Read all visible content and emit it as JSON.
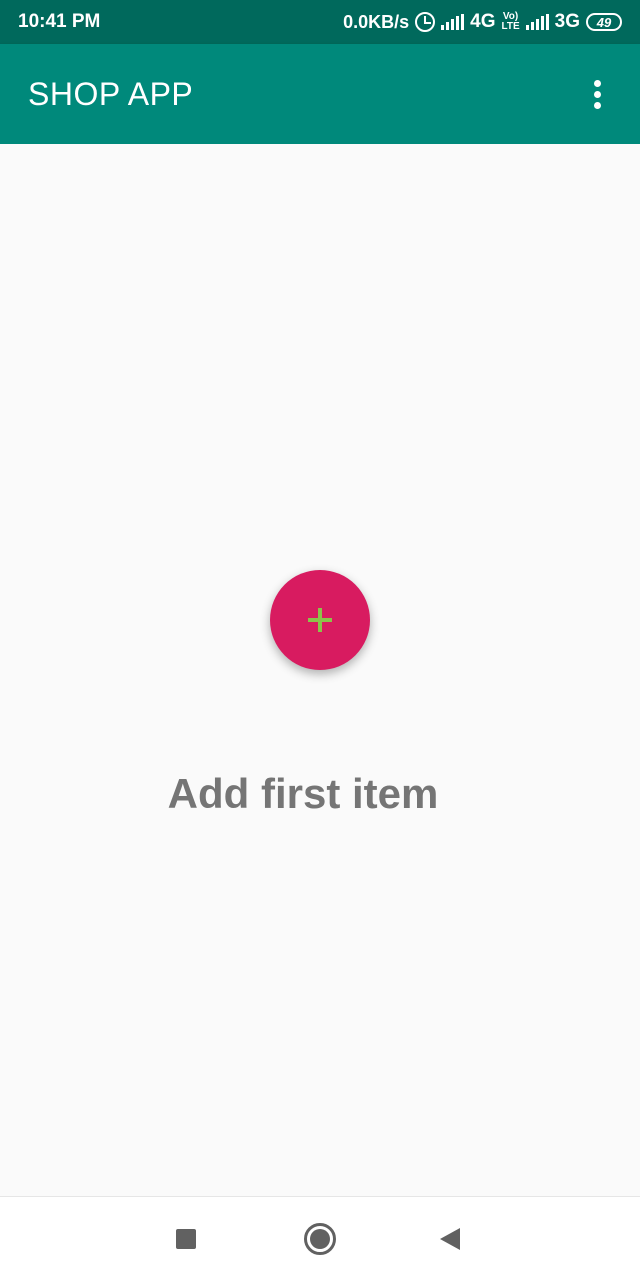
{
  "status_bar": {
    "time": "10:41 PM",
    "network_speed": "0.0KB/s",
    "sim1_network": "4G",
    "sim1_sub": "↑↓",
    "volte_top": "Vo)",
    "volte_bottom": "LTE",
    "sim2_network": "3G",
    "battery_level": "49",
    "icons": [
      "alarm-icon",
      "signal-icon",
      "volte-icon",
      "signal-icon",
      "battery-icon"
    ]
  },
  "app_bar": {
    "title": "SHOP APP",
    "menu_icon": "more-vert-icon"
  },
  "main": {
    "fab_icon": "plus-icon",
    "empty_message": "Add first item"
  },
  "nav_bar": {
    "recents_icon": "square-icon",
    "home_icon": "circle-icon",
    "back_icon": "triangle-back-icon"
  },
  "colors": {
    "status_bar": "#00695c",
    "app_bar": "#00897b",
    "fab": "#d81b60",
    "fab_icon": "#8bc34a",
    "empty_text": "#757575",
    "background": "#fafafa"
  }
}
